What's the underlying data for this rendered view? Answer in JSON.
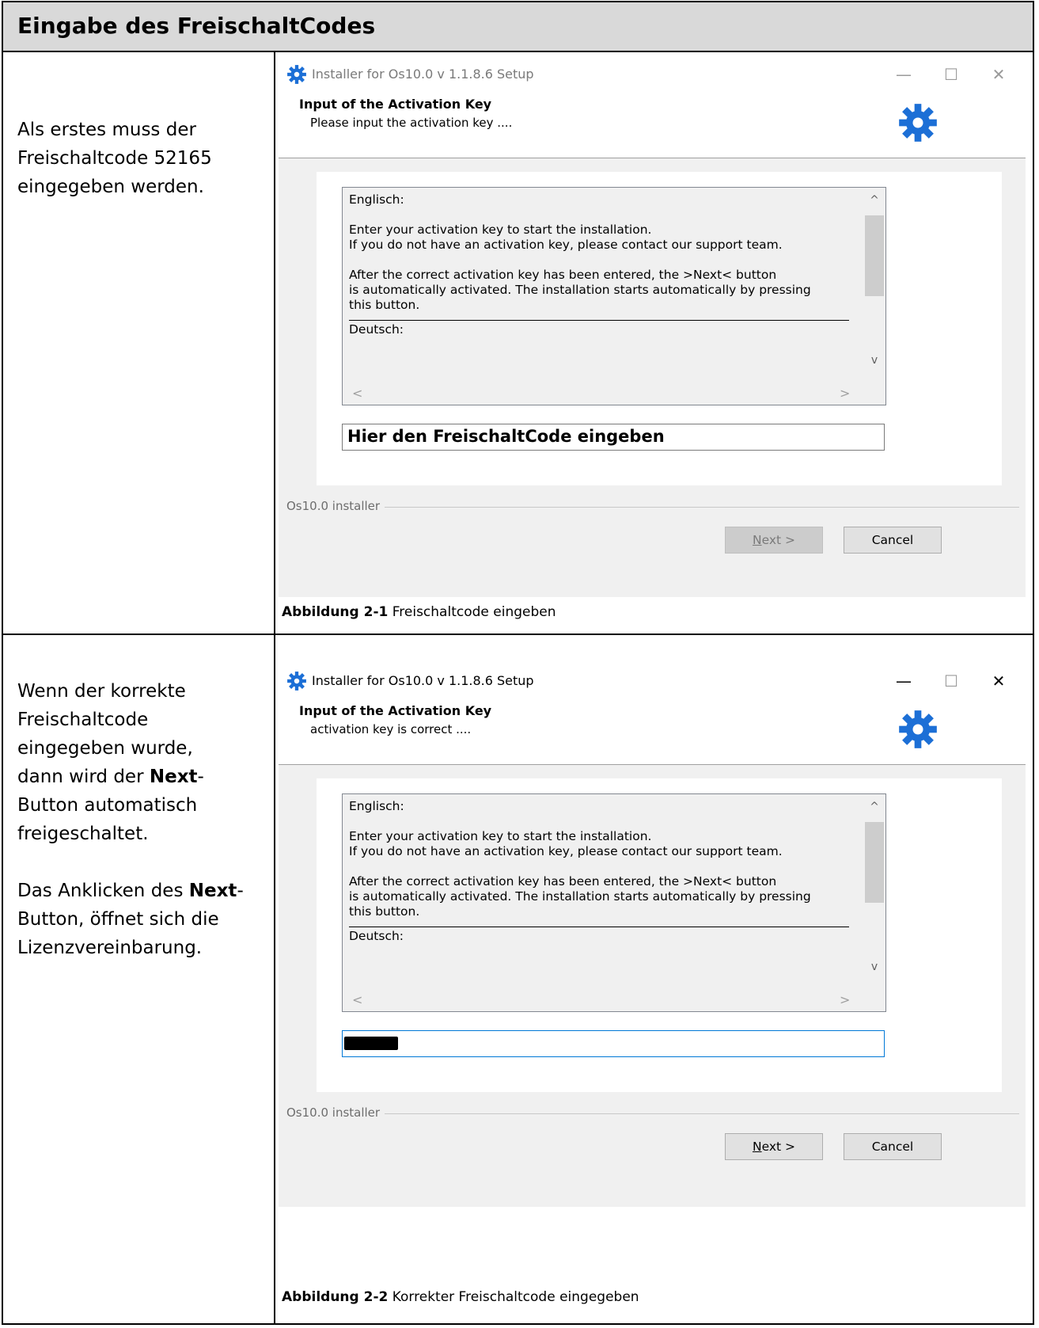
{
  "header": {
    "title": "Eingabe des FreischaltCodes"
  },
  "section1": {
    "description": [
      "Als erstes muss der",
      "Freischaltcode 52165",
      "eingegeben werden."
    ],
    "window": {
      "title": "Installer for Os10.0 v 1.1.8.6 Setup",
      "heading": "Input of the Activation Key",
      "subheading": "Please input the activation key ....",
      "info_lines": {
        "l1": "Englisch:",
        "l2": "Enter your activation key to start the installation.",
        "l3": "If you do not have an activation key, please contact our support team.",
        "l4": "After the correct activation key has been entered, the >Next< button",
        "l5": "is automatically activated. The installation starts automatically by pressing",
        "l6": "this button.",
        "l7": "Deutsch:"
      },
      "key_placeholder": "Hier den FreischaltCode eingeben",
      "branding": "Os10.0 installer",
      "next_label_underlined": "N",
      "next_label_rest": "ext >",
      "next_enabled": false,
      "cancel_label": "Cancel"
    },
    "caption_bold": "Abbildung 2-1",
    "caption_text": " Freischaltcode eingeben"
  },
  "section2": {
    "description": {
      "p1a": "Wenn der korrekte",
      "p1b": "Freischaltcode",
      "p1c": "eingegeben wurde,",
      "p1d": "dann wird der ",
      "p1d_bold": "Next",
      "p1d_end": "-",
      "p1e": "Button automatisch",
      "p1f": "freigeschaltet.",
      "p2a": "Das Anklicken des ",
      "p2a_bold": "Next",
      "p2a_end": "-",
      "p2b": "Button, öffnet sich die",
      "p2c": "Lizenzvereinbarung."
    },
    "window": {
      "title": "Installer for Os10.0 v 1.1.8.6 Setup",
      "heading": "Input of the Activation Key",
      "subheading": "activation key is correct ....",
      "info_lines": {
        "l1": "Englisch:",
        "l2": "Enter your activation key to start the installation.",
        "l3": "If you do not have an activation key, please contact our support team.",
        "l4": "After the correct activation key has been entered, the >Next< button",
        "l5": "is automatically activated. The installation starts automatically by pressing",
        "l6": "this button.",
        "l7": "Deutsch:"
      },
      "branding": "Os10.0 installer",
      "next_label_underlined": "N",
      "next_label_rest": "ext >",
      "next_enabled": true,
      "cancel_label": "Cancel"
    },
    "caption_bold": "Abbildung 2-2",
    "caption_text": " Korrekter Freischaltcode eingegeben"
  },
  "window_controls": {
    "minimize": "—",
    "maximize": "☐",
    "close": "✕"
  },
  "icons": {
    "app": "gear-icon",
    "header": "gear-icon"
  },
  "colors": {
    "gear_blue": "#1c6fd6",
    "header_bg": "#d9d9d9",
    "focus_border": "#0078d7"
  }
}
